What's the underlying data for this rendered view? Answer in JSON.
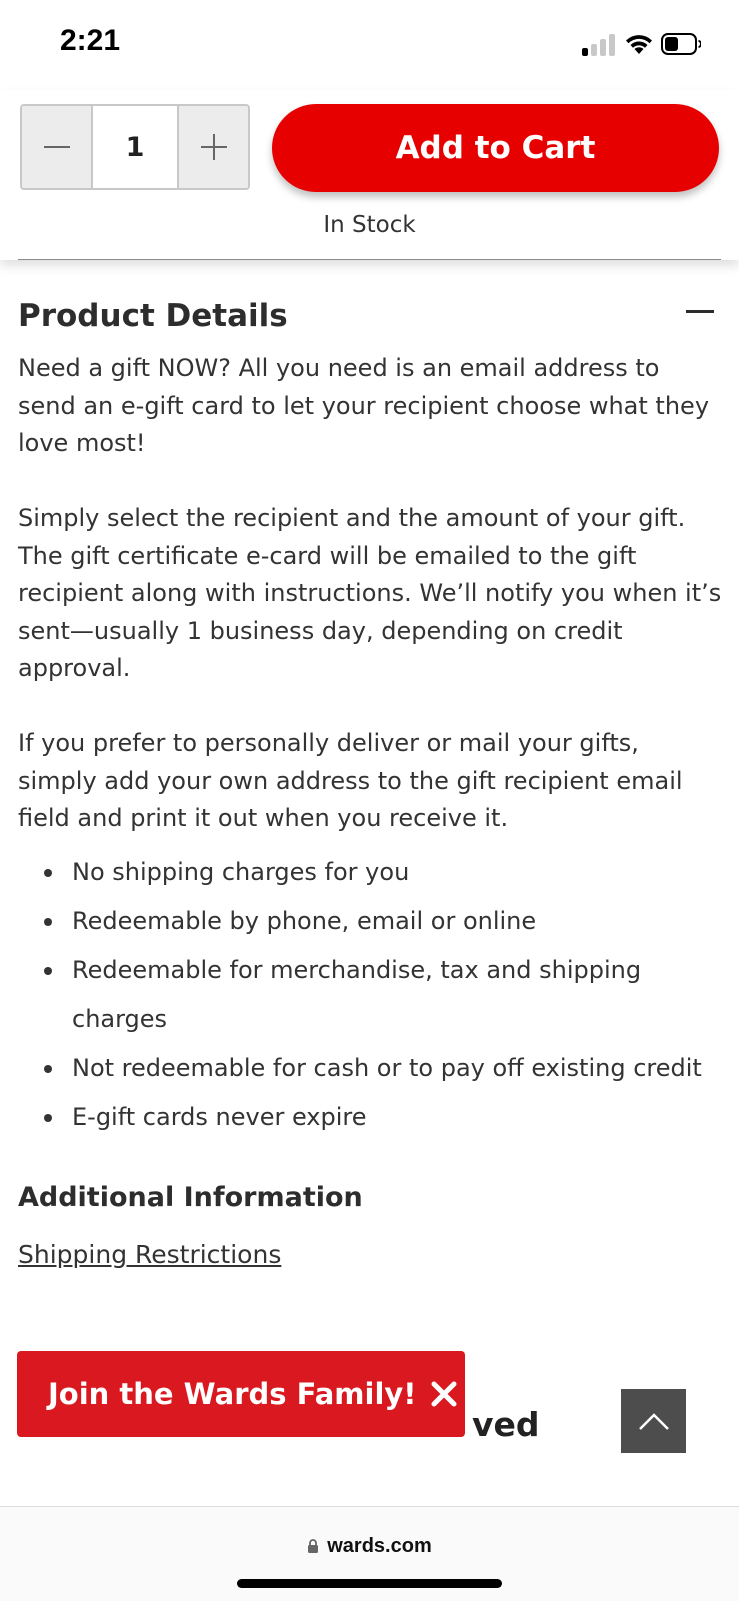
{
  "status_bar": {
    "time": "2:21",
    "signal_bars_active": 1,
    "signal_bars_total": 4
  },
  "purchase": {
    "quantity": "1",
    "add_to_cart_label": "Add to Cart",
    "stock_status": "In Stock",
    "accent_color": "#e60000"
  },
  "product_details": {
    "title": "Product Details",
    "paragraphs": [
      "Need a gift NOW? All you need is an email address to send an e-gift card to let your recipient choose what they love most!",
      "Simply select the recipient and the amount of your gift. The gift certificate e-card will be emailed to the gift recipient along with instructions. We’ll notify you when it’s sent—usually 1 business day, depending on credit approval.",
      "If you prefer to personally deliver or mail your gifts, simply add your own address to the gift recipient email field and print it out when you receive it."
    ],
    "bullets": [
      "No shipping charges for you",
      "Redeemable by phone, email or online",
      "Redeemable for merchandise, tax and shipping charges",
      "Not redeemable for cash or to pay off existing credit",
      "E-gift cards never expire"
    ]
  },
  "additional_information": {
    "title": "Additional Information",
    "shipping_link": "Shipping Restrictions"
  },
  "partially_hidden_heading": "ved",
  "join_banner": {
    "text": "Join the Wards Family!",
    "color": "#d9191f"
  },
  "browser": {
    "url": "wards.com"
  }
}
